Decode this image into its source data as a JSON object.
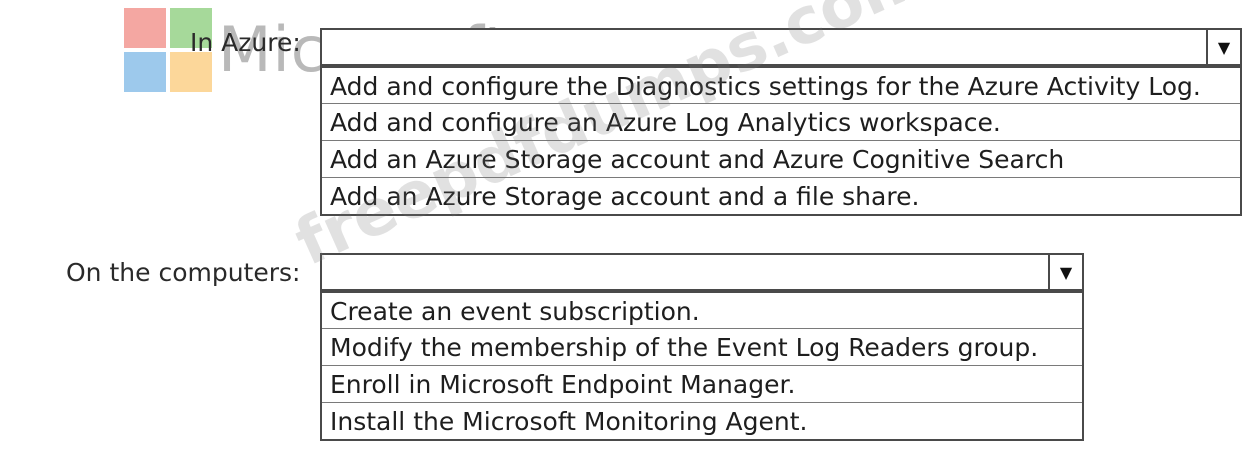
{
  "logo": {
    "text": "Microsoft"
  },
  "watermark": {
    "text": "freepdfdumps.com"
  },
  "azure": {
    "label": "In Azure:",
    "selected": "",
    "options": [
      "Add and configure the Diagnostics settings for the Azure Activity Log.",
      "Add and configure an Azure Log Analytics workspace.",
      "Add an Azure Storage account and Azure Cognitive Search",
      "Add an Azure Storage account and a file share."
    ]
  },
  "computers": {
    "label": "On the computers:",
    "selected": "",
    "options": [
      "Create an event subscription.",
      "Modify the membership of the Event Log Readers group.",
      "Enroll in Microsoft Endpoint Manager.",
      "Install the Microsoft Monitoring Agent."
    ]
  },
  "icons": {
    "dropdown_arrow": "▼"
  }
}
